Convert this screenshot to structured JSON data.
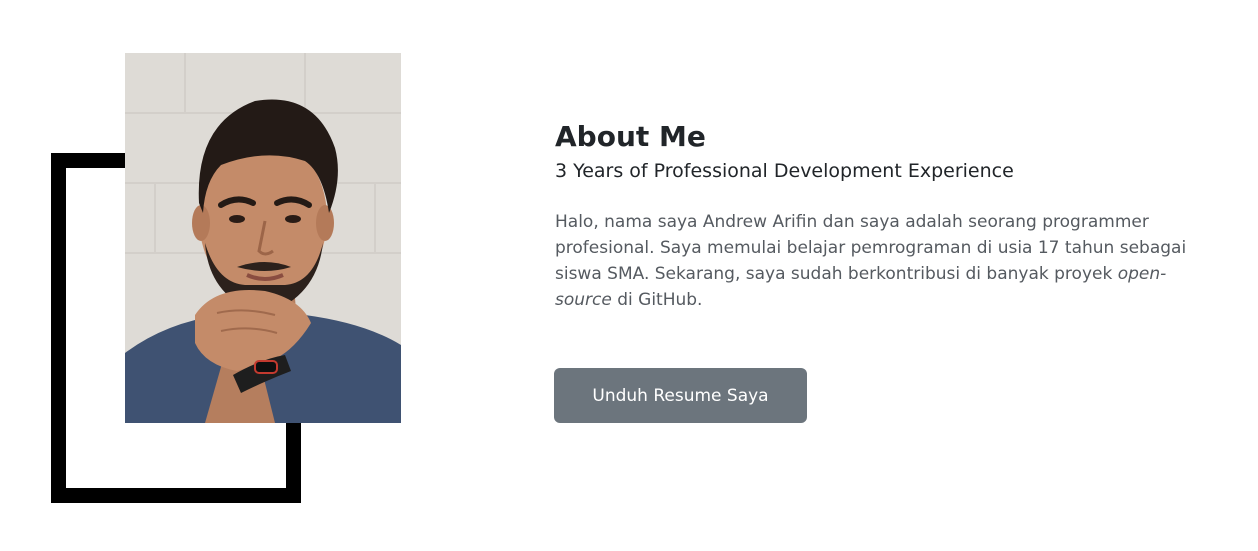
{
  "about": {
    "photo_alt": "Andrew Arifin",
    "title": "About Me",
    "subtitle": "3 Years of Professional Development Experience",
    "bio_part1": "Halo, nama saya Andrew Arifin dan saya adalah seorang programmer profesional. Saya memulai belajar pemrograman di usia 17 tahun sebagai siswa SMA. Sekarang, saya sudah berkontribusi di banyak proyek ",
    "bio_em": "open-source",
    "bio_part2": " di GitHub.",
    "button_label": "Unduh Resume Saya"
  },
  "colors": {
    "frame": "#000000",
    "button_bg": "#6c757d",
    "button_text": "#ffffff",
    "heading": "#212529",
    "body_text": "#555a60"
  }
}
